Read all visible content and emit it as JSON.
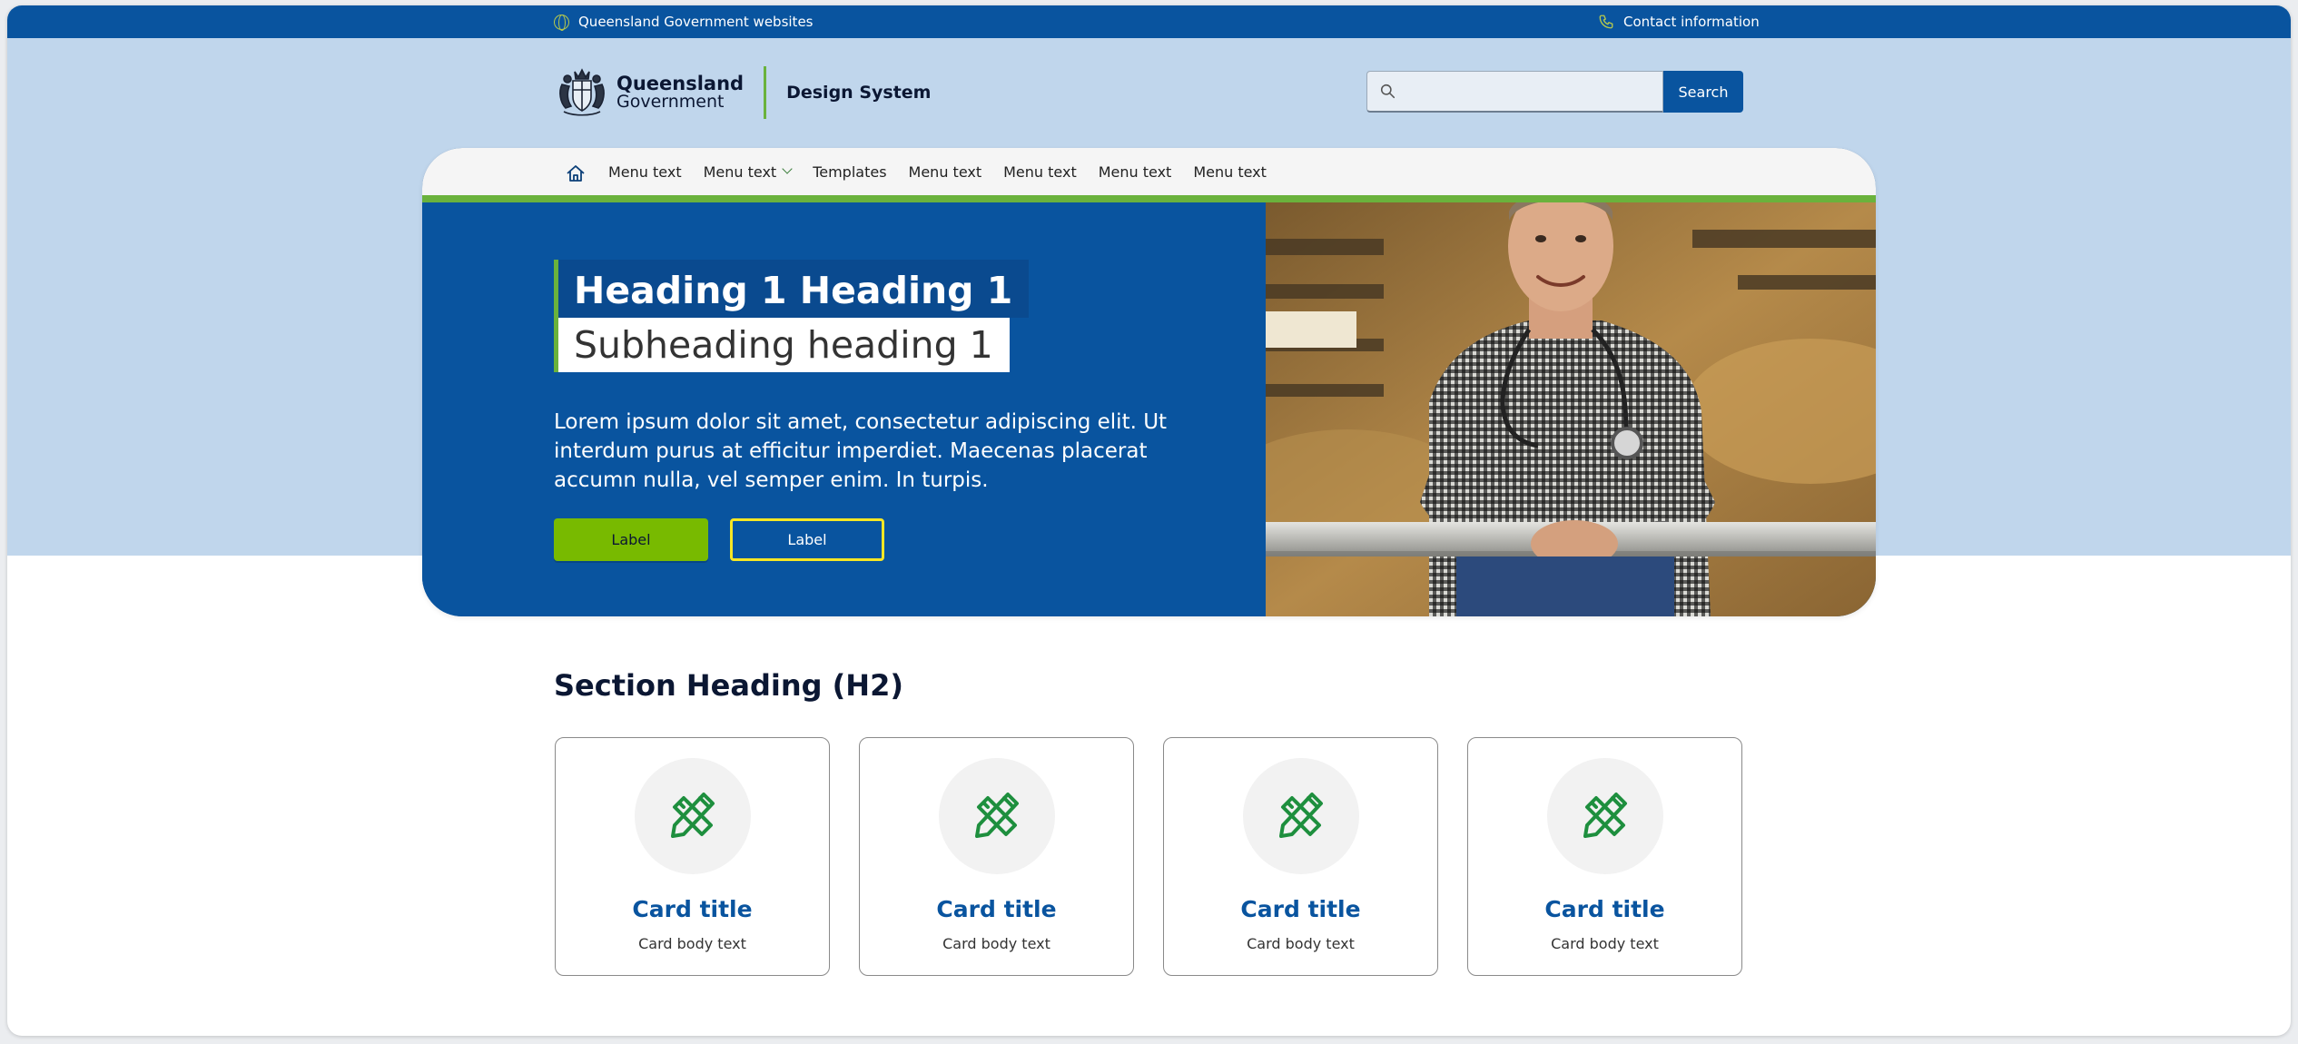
{
  "utility_bar": {
    "left_text": "Queensland Government websites",
    "right_text": "Contact information"
  },
  "header": {
    "logo_line1": "Queensland",
    "logo_line2": "Government",
    "site_name": "Design System",
    "search_placeholder": "",
    "search_button": "Search"
  },
  "nav": {
    "items": [
      "Menu text",
      "Menu text",
      "Templates",
      "Menu text",
      "Menu text",
      "Menu text",
      "Menu text"
    ]
  },
  "hero": {
    "heading": "Heading 1 Heading 1",
    "subheading": "Subheading heading 1",
    "body": "Lorem ipsum dolor sit amet, consectetur adipiscing elit. Ut interdum purus at efficitur imperdiet. Maecenas placerat accumn nulla, vel semper enim. In turpis.",
    "primary_label": "Label",
    "secondary_label": "Label"
  },
  "section": {
    "heading": "Section Heading (H2)",
    "cards": [
      {
        "title": "Card title",
        "body": "Card body text"
      },
      {
        "title": "Card title",
        "body": "Card body text"
      },
      {
        "title": "Card title",
        "body": "Card body text"
      },
      {
        "title": "Card title",
        "body": "Card body text"
      }
    ]
  },
  "colors": {
    "primary_blue": "#09549f",
    "light_blue": "#c0d6ec",
    "accent_green": "#6ab23c",
    "button_green": "#78ba00",
    "outline_yellow": "#f6e625"
  },
  "icons": [
    "globe-icon",
    "phone-icon",
    "search-icon",
    "home-icon",
    "chevron-down-icon",
    "pencil-ruler-icon"
  ]
}
